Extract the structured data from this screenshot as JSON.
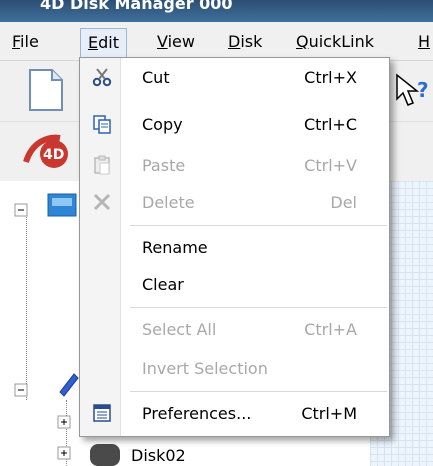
{
  "window": {
    "title": "4D Disk Manager 000"
  },
  "menubar": {
    "items": [
      {
        "label": "File",
        "ul": "F"
      },
      {
        "label": "Edit",
        "ul": "E"
      },
      {
        "label": "View",
        "ul": "V"
      },
      {
        "label": "Disk",
        "ul": "D"
      },
      {
        "label": "QuickLink",
        "ul": "Q"
      },
      {
        "label": "H"
      }
    ]
  },
  "tree": {
    "visible_item": "Disk02"
  },
  "edit_menu": {
    "items": [
      {
        "label": "Cut",
        "shortcut": "Ctrl+X",
        "enabled": true,
        "icon": "scissors-icon"
      },
      {
        "label": "Copy",
        "shortcut": "Ctrl+C",
        "enabled": true,
        "icon": "copy-icon"
      },
      {
        "label": "Paste",
        "shortcut": "Ctrl+V",
        "enabled": false,
        "icon": "paste-icon"
      },
      {
        "label": "Delete",
        "shortcut": "Del",
        "enabled": false,
        "icon": "delete-x-icon"
      },
      {
        "label": "Rename",
        "shortcut": "",
        "enabled": true
      },
      {
        "label": "Clear",
        "shortcut": "",
        "enabled": true
      },
      {
        "label": "Select All",
        "shortcut": "Ctrl+A",
        "enabled": false
      },
      {
        "label": "Invert Selection",
        "shortcut": "",
        "enabled": false
      },
      {
        "label": "Preferences...",
        "shortcut": "Ctrl+M",
        "enabled": true,
        "icon": "preferences-icon"
      }
    ]
  },
  "colors": {
    "accent": "#3f6f9a",
    "disabled": "#a8a8a8"
  }
}
